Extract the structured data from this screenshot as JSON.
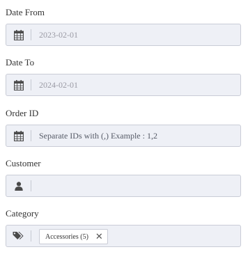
{
  "fields": {
    "date_from": {
      "label": "Date From",
      "value": "2023-02-01",
      "icon": "calendar-icon"
    },
    "date_to": {
      "label": "Date To",
      "value": "2024-02-01",
      "icon": "calendar-icon"
    },
    "order_id": {
      "label": "Order ID",
      "placeholder": "Separate IDs with (,) Example : 1,2",
      "icon": "calendar-icon"
    },
    "customer": {
      "label": "Customer",
      "value": "",
      "icon": "user-icon"
    },
    "category": {
      "label": "Category",
      "icon": "tags-icon",
      "chips": [
        {
          "label": "Accessories (5)"
        }
      ]
    }
  },
  "colors": {
    "input_bg": "#eef0f6",
    "input_border": "#c9ccd6",
    "icon": "#4a4a4a",
    "value_text": "#9a9aa4"
  }
}
